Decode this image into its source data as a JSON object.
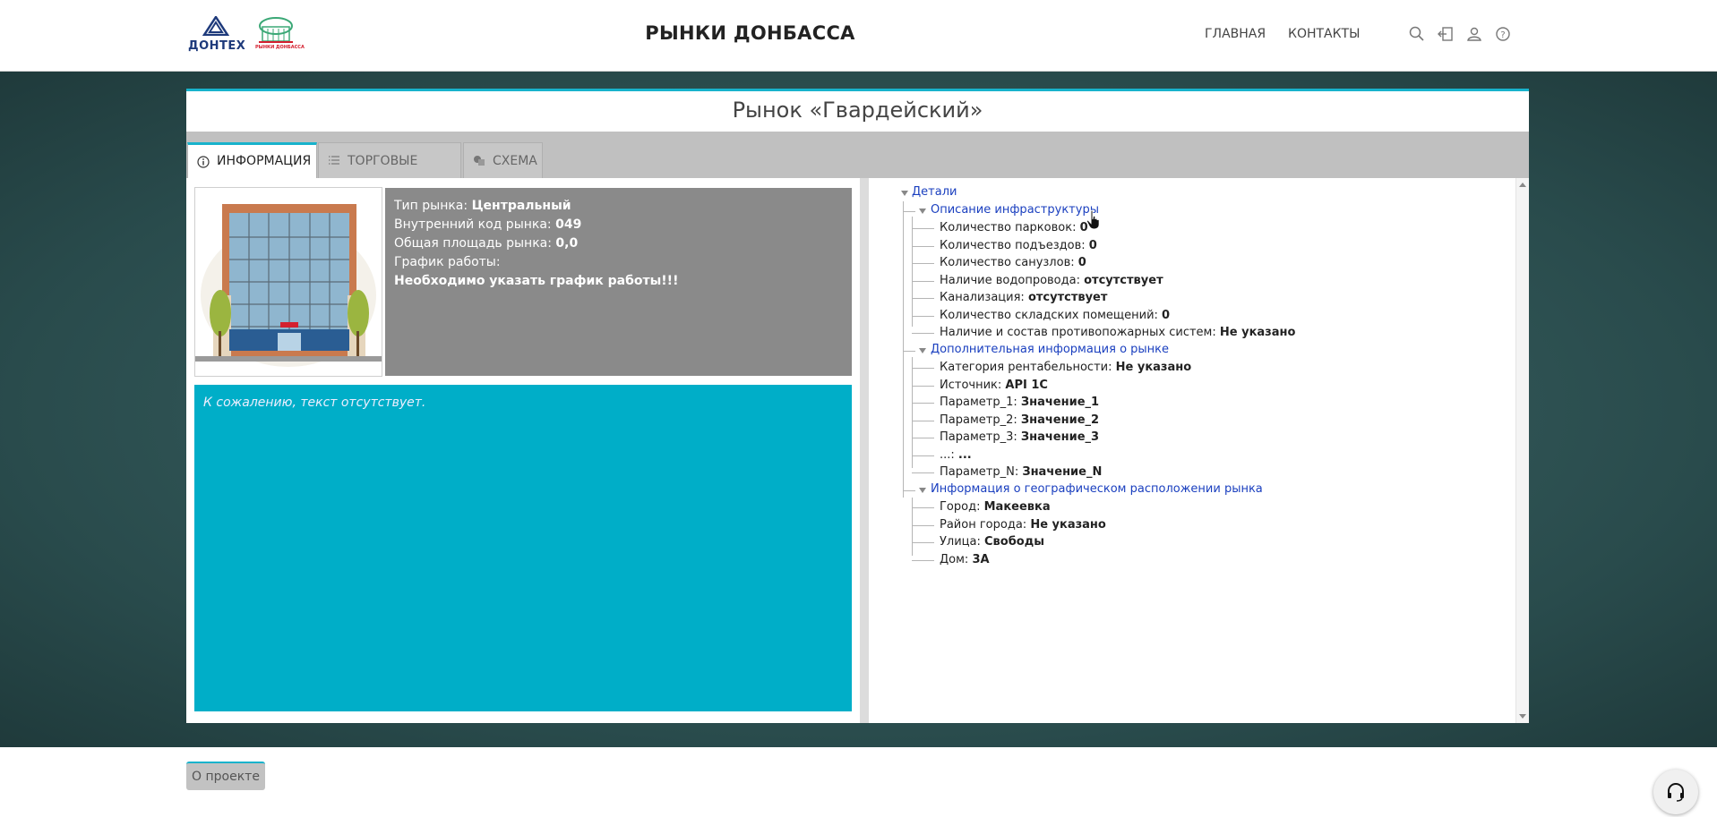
{
  "header": {
    "logo_dontex": "ДОНТЕХ",
    "logo_rynki": "РЫНКИ ДОНБАССА",
    "site_title": "РЫНКИ ДОНБАССА",
    "nav": {
      "home": "ГЛАВНАЯ",
      "contacts": "КОНТАКТЫ"
    },
    "icons": [
      "search-icon",
      "login-icon",
      "user-icon",
      "help-icon"
    ]
  },
  "market": {
    "title": "Рынок «Гвардейский»",
    "tabs": [
      {
        "label": "ИНФОРМАЦИЯ",
        "icon": "info-icon",
        "active": true
      },
      {
        "label": "ТОРГОВЫЕ МЕСТА",
        "icon": "list-icon",
        "active": false
      },
      {
        "label": "СХЕМА",
        "icon": "scheme-icon",
        "active": false
      }
    ],
    "info": {
      "type_label": "Тип рынка:",
      "type_value": "Центральный",
      "code_label": "Внутренний код рынка:",
      "code_value": "049",
      "area_label": "Общая площадь рынка:",
      "area_value": "0,0",
      "schedule_label": "График работы:",
      "schedule_value": "Необходимо указать график работы!!!"
    },
    "description": "К сожалению, текст отсутствует."
  },
  "tree": {
    "root": "Детали",
    "infra": {
      "label": "Описание инфраструктуры",
      "items": [
        {
          "k": "Количество парковок:",
          "v": "0"
        },
        {
          "k": "Количество подъездов:",
          "v": "0"
        },
        {
          "k": "Количество санузлов:",
          "v": "0"
        },
        {
          "k": "Наличие водопровода:",
          "v": "отсутствует"
        },
        {
          "k": "Канализация:",
          "v": "отсутствует"
        },
        {
          "k": "Количество складских помещений:",
          "v": "0"
        },
        {
          "k": "Наличие и состав противопожарных систем:",
          "v": "Не указано"
        }
      ]
    },
    "extra": {
      "label": "Дополнительная информация о рынке",
      "items": [
        {
          "k": "Категория рентабельности:",
          "v": "Не указано"
        },
        {
          "k": "Источник:",
          "v": "API 1C"
        },
        {
          "k": "Параметр_1:",
          "v": "Значение_1"
        },
        {
          "k": "Параметр_2:",
          "v": "Значение_2"
        },
        {
          "k": "Параметр_3:",
          "v": "Значение_3"
        },
        {
          "k": "...:",
          "v": "..."
        },
        {
          "k": "Параметр_N:",
          "v": "Значение_N"
        }
      ]
    },
    "geo": {
      "label": "Информация о географическом расположении рынка",
      "items": [
        {
          "k": "Город:",
          "v": "Макеевка"
        },
        {
          "k": "Район города:",
          "v": "Не указано"
        },
        {
          "k": "Улица:",
          "v": "Свободы"
        },
        {
          "k": "Дом:",
          "v": "3А"
        }
      ]
    }
  },
  "footer": {
    "about": "О проекте",
    "support_icon": "headset-icon"
  }
}
